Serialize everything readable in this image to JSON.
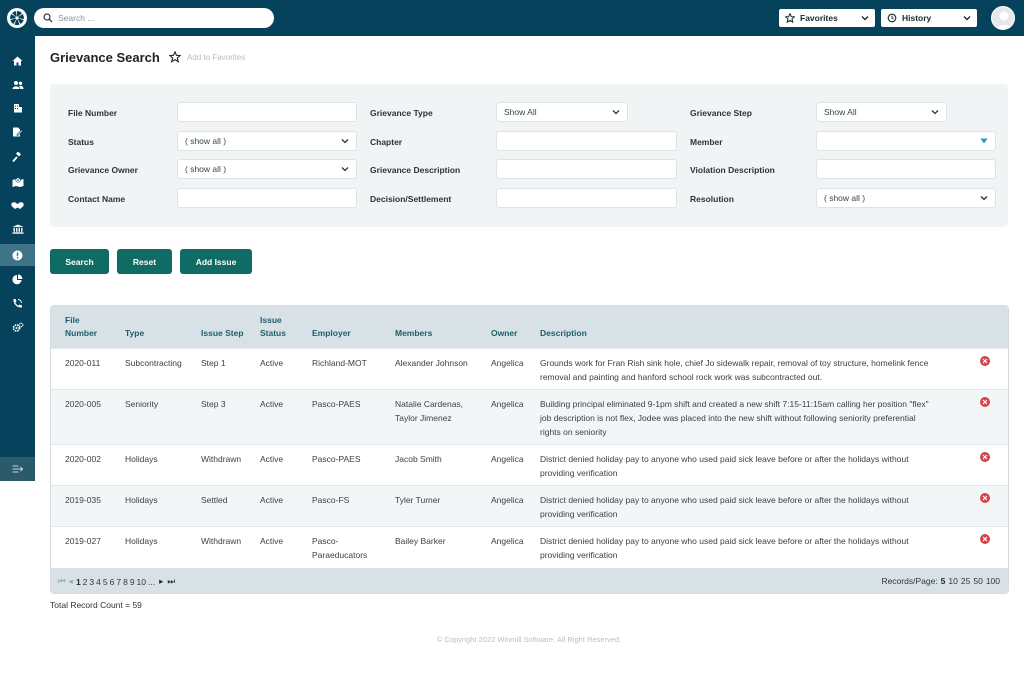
{
  "topbar": {
    "search_placeholder": "Search ...",
    "favorites_label": "Favorites",
    "history_label": "History"
  },
  "sidebar": {
    "items": [
      {
        "icon": "home-icon"
      },
      {
        "icon": "users-icon"
      },
      {
        "icon": "building-icon"
      },
      {
        "icon": "document-edit-icon"
      },
      {
        "icon": "gavel-icon"
      },
      {
        "icon": "map-icon"
      },
      {
        "icon": "handshake-icon"
      },
      {
        "icon": "bank-icon"
      },
      {
        "icon": "grievance-alert-icon",
        "active": true
      },
      {
        "icon": "pie-chart-icon"
      },
      {
        "icon": "phone-signal-icon"
      },
      {
        "icon": "gears-icon"
      }
    ],
    "collapse_icon": "collapse-sidebar-icon"
  },
  "page": {
    "title": "Grievance Search",
    "add_favorites": "Add to Favorites"
  },
  "filters": {
    "file_number_label": "File Number",
    "file_number_value": "",
    "status_label": "Status",
    "status_value": "( show all )",
    "owner_label": "Grievance Owner",
    "owner_value": "( show all )",
    "contact_label": "Contact Name",
    "contact_value": "",
    "type_label": "Grievance Type",
    "type_value": "Show All",
    "chapter_label": "Chapter",
    "chapter_value": "",
    "description_label": "Grievance Description",
    "description_value": "",
    "decision_label": "Decision/Settlement",
    "decision_value": "",
    "step_label": "Grievance Step",
    "step_value": "Show All",
    "member_label": "Member",
    "member_value": "",
    "violation_label": "Violation Description",
    "violation_value": "",
    "resolution_label": "Resolution",
    "resolution_value": "( show all )"
  },
  "actions": {
    "search": "Search",
    "reset": "Reset",
    "add_issue": "Add Issue"
  },
  "table": {
    "headers": {
      "file_number_line1": "File",
      "file_number_line2": "Number",
      "type": "Type",
      "issue_step": "Issue Step",
      "issue_status_line1": "Issue",
      "issue_status_line2": "Status",
      "employer": "Employer",
      "members": "Members",
      "owner": "Owner",
      "description": "Description"
    },
    "rows": [
      {
        "file": "2020-011",
        "type": "Subcontracting",
        "step": "Step 1",
        "status": "Active",
        "employer_line1": "Richland-MOT",
        "employer_line2": "",
        "members_line1": "Alexander Johnson",
        "members_line2": "",
        "owner": "Angelica",
        "desc_line1": "Grounds work for Fran Rish sink hole, chief Jo sidewalk repair, removal of toy structure, homelink fence",
        "desc_line2": "removal and painting and hanford school rock work was subcontracted out.",
        "desc_line3": ""
      },
      {
        "file": "2020-005",
        "type": "Seniority",
        "step": "Step 3",
        "status": "Active",
        "employer_line1": "Pasco-PAES",
        "employer_line2": "",
        "members_line1": "Natalie Cardenas,",
        "members_line2": "Taylor Jimenez",
        "owner": "Angelica",
        "desc_line1": "Building principal eliminated 9-1pm shift and created a new shift 7:15-11:15am calling her position \"flex\"",
        "desc_line2": "job description is not flex, Jodee was placed into the new shift without following seniority preferential",
        "desc_line3": "rights on seniority"
      },
      {
        "file": "2020-002",
        "type": "Holidays",
        "step": "Withdrawn",
        "status": "Active",
        "employer_line1": "Pasco-PAES",
        "employer_line2": "",
        "members_line1": "Jacob Smith",
        "members_line2": "",
        "owner": "Angelica",
        "desc_line1": "District denied holiday pay to anyone who used paid sick leave before or after the holidays without",
        "desc_line2": "providing verification",
        "desc_line3": ""
      },
      {
        "file": "2019-035",
        "type": "Holidays",
        "step": "Settled",
        "status": "Active",
        "employer_line1": "Pasco-FS",
        "employer_line2": "",
        "members_line1": "Tyler Turner",
        "members_line2": "",
        "owner": "Angelica",
        "desc_line1": "District denied holiday pay to anyone who used paid sick leave before or after the holidays without",
        "desc_line2": "providing verification",
        "desc_line3": ""
      },
      {
        "file": "2019-027",
        "type": "Holidays",
        "step": "Withdrawn",
        "status": "Active",
        "employer_line1": "Pasco-",
        "employer_line2": "Paraeducators",
        "members_line1": "Bailey Barker",
        "members_line2": "",
        "owner": "Angelica",
        "desc_line1": "District denied holiday pay to anyone who used paid sick leave before or after the holidays without",
        "desc_line2": "providing verification",
        "desc_line3": ""
      }
    ]
  },
  "pagination": {
    "pages": [
      "1",
      "2",
      "3",
      "4",
      "5",
      "6",
      "7",
      "8",
      "9",
      "10",
      "..."
    ],
    "current_page": "1",
    "records_label": "Records/Page:",
    "page_sizes": [
      "5",
      "10",
      "25",
      "50",
      "100"
    ],
    "current_size": "5"
  },
  "footer": {
    "total": "Total Record Count = 59",
    "copyright": "© Copyright 2022 Winmill Software. All Right Reserved."
  },
  "colors": {
    "brand": "#06425c",
    "button": "#0f6b63",
    "delete": "#d8404a",
    "header_text": "#1f5d6b"
  }
}
